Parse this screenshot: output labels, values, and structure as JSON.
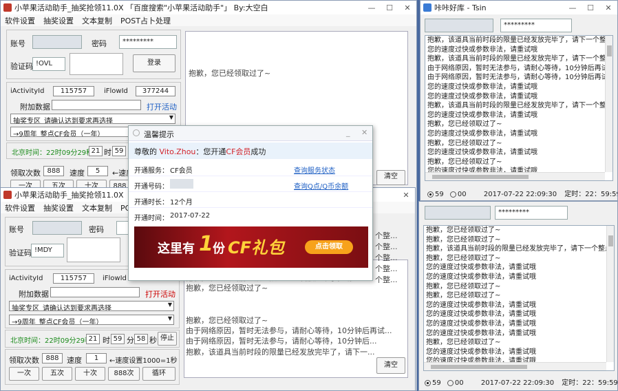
{
  "back_window": {
    "title": "小苹果活动助手_抽奖抢领11.0X 「百度搜索\"小苹果活动助手\"」 By:大空白",
    "menu": [
      "软件设置",
      "抽奖设置",
      "文本复制",
      "POST占卜处理"
    ],
    "account_label": "账号",
    "password_label": "密码",
    "password_value": "*********",
    "captcha_label": "验证码",
    "captcha_value": "!OVL",
    "login_label": "登录",
    "activity_label": "iActivityId",
    "activity_value": "115757",
    "flow_label": "iFlowId",
    "flow_value": "377244",
    "extra_label": "附加数据",
    "open_activity": "打开活动",
    "select1": "抽奖专区_请确认达到要求再选择",
    "select2": "→9周年_整点CF会员（一年）",
    "beijing_time": "北京时间：22时09分29秒",
    "hour": "21",
    "hour_unit": "时",
    "minute": "59",
    "count_label": "领取次数",
    "count_value": "888",
    "speed_label": "速度",
    "speed_value": "5",
    "speed_hint": "←速度",
    "btns": [
      "一次",
      "五次",
      "十次",
      "888"
    ],
    "clear_label": "清空",
    "log_message": "抱歉，您已经领取过了~"
  },
  "front_window": {
    "title": "小苹果活动助手_抽奖抢领11.0X 「百度",
    "menu": [
      "软件设置",
      "抽奖设置",
      "文本复制",
      "POST占"
    ],
    "account_label": "账号",
    "password_label": "密码",
    "captcha_label": "验证码",
    "captcha_value": "!MDY",
    "activity_label": "iActivityId",
    "activity_value": "115757",
    "flow_label": "iFlowId",
    "extra_label": "附加数据",
    "open_activity": "打开活动",
    "select1": "抽奖专区_请确认达到要求再选择",
    "select2": "→9周年_整点CF会员（一年）",
    "beijing_time": "北京时间：22时09分29秒",
    "hour": "21",
    "hour_unit": "时",
    "minute": "59",
    "minute_unit": "分",
    "second": "58",
    "second_unit": "秒",
    "stop_label": "停止",
    "count_label": "领取次数",
    "count_value": "888",
    "speed_label": "速度",
    "speed_value": "1",
    "speed_hint": "←速度设置1000=1秒",
    "btns": [
      "一次",
      "五次",
      "十次",
      "888次",
      "循环"
    ],
    "clear_label": "清空",
    "log_lines": [
      "抱歉，该道具当前时段的限量已经发放完毕了，请...",
      "抱歉，您已经领取过了~",
      "",
      "",
      "抱歉，您已经领取过了~",
      "由于网络原因，暂时无法参与，请耐心等待，10分钟后再试...",
      "由于网络原因，暂时无法参与，请耐心等待，10分钟后...",
      "抱歉，该道具当前时段的限量已经发放完毕了，请下一..."
    ],
    "side_fragments": [
      "个整...",
      "个整...",
      "个整...",
      "个整...",
      "个整..."
    ]
  },
  "popup": {
    "title": "温馨提示",
    "greet_prefix": "尊敬的",
    "user": "Vito.Zhou",
    "greet_mid": "：您开通",
    "vip": "CF会员",
    "greet_suffix": "成功",
    "rows": [
      {
        "label": "开通服务：",
        "value": "CF会员",
        "link": "查询服务状态"
      },
      {
        "label": "开通号码：",
        "value": "",
        "link": "查询Q点/Q币余额"
      },
      {
        "label": "开通时长：",
        "value": "12个月",
        "link": ""
      },
      {
        "label": "开通时间：",
        "value": "2017-07-22",
        "link": ""
      }
    ],
    "banner_text_a": "这里有",
    "banner_text_num": "1",
    "banner_text_b": "份",
    "banner_text_c": "CF礼包",
    "banner_button": "点击领取"
  },
  "right_top": {
    "title": "咔咔好库 - Tsin",
    "password_value": "*********",
    "log_lines": [
      "抱歉，该道具当前时段的限量已经发放完毕了，请下一个整点",
      "您的速度过快或参数非法，请重试哦",
      "抱歉，该道具当前时段的限量已经发放完毕了，请下一个整点",
      "由于网络原因，暂时无法参与，请耐心等待，10分钟后再试",
      "由于网络原因，暂时无法参与，请耐心等待，10分钟后再试",
      "您的速度过快或参数非法，请重试哦",
      "您的速度过快或参数非法，请重试哦",
      "抱歉，该道具当前时段的限量已经发放完毕了，请下一个整点",
      "您的速度过快或参数非法，请重试哦",
      "抱歉，您已经领取过了~",
      "您的速度过快或参数非法，请重试哦",
      "抱歉，您已经领取过了~",
      "您的速度过快或参数非法，请重试哦",
      "抱歉，您已经领取过了~",
      "您的速度过快或参数非法，请重试哦"
    ],
    "radio1": "59",
    "radio2": "00",
    "datetime": "2017-07-22 22:09:30",
    "timer": "定时：22：59:59"
  },
  "right_bottom": {
    "password_value": "*********",
    "log_lines": [
      "抱歉，您已经领取过了~",
      "抱歉，您已经领取过了~",
      "抱歉，该道具当前时段的限量已经发放完毕了，请下一个整点",
      "抱歉，您已经领取过了~",
      "您的速度过快或参数非法，请重试哦",
      "您的速度过快或参数非法，请重试哦",
      "抱歉，您已经领取过了~",
      "抱歉，您已经领取过了~",
      "您的速度过快或参数非法，请重试哦",
      "您的速度过快或参数非法，请重试哦",
      "您的速度过快或参数非法，请重试哦",
      "您的速度过快或参数非法，请重试哦",
      "抱歉，您已经领取过了~",
      "您的速度过快或参数非法，请重试哦",
      "您的速度过快或参数非法，请重试哦"
    ],
    "radio1": "59",
    "radio2": "00",
    "datetime": "2017-07-22 22:09:30",
    "timer": "定时：22：59:59"
  },
  "colors": {
    "green": "#1a8a1a",
    "link": "#1e5fc4",
    "red": "#cc0000",
    "banner": "#b2161c"
  }
}
